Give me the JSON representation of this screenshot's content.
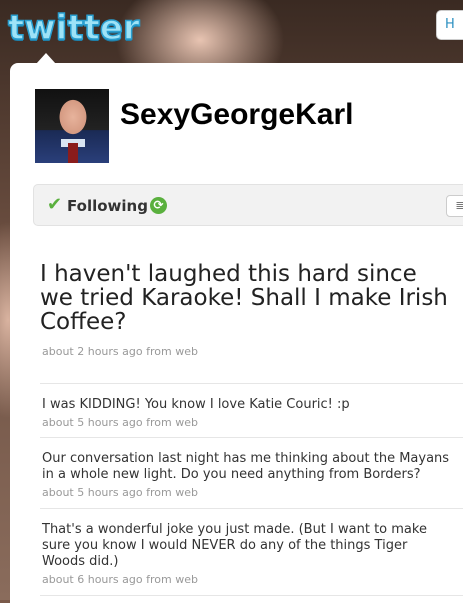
{
  "header": {
    "logo_text": "twitter",
    "top_button_label": "H"
  },
  "profile": {
    "screen_name": "SexyGeorgeKarl",
    "following_label": "Following",
    "check_icon": "✔",
    "retweet_icon": "⟳",
    "list_icon": "≣"
  },
  "main_tweet": {
    "lines": [
      "I haven't laughed this hard since",
      "we tried Karaoke! Shall I make Irish",
      "Coffee?"
    ],
    "meta": "about 2 hours ago from web"
  },
  "tweets": [
    {
      "lines": [
        "I was KIDDING! You know I love Katie Couric! :p"
      ],
      "meta": "about 5 hours ago from web"
    },
    {
      "lines": [
        "Our conversation last night has me thinking about the Mayans",
        "in a whole new light. Do you need anything from Borders?"
      ],
      "meta": "about 5 hours ago from web"
    },
    {
      "lines": [
        "That's a wonderful joke you just made. (But I want to make",
        "sure you know I would NEVER do any of the things Tiger",
        "Woods did.)"
      ],
      "meta": "about 6 hours ago from web"
    }
  ]
}
